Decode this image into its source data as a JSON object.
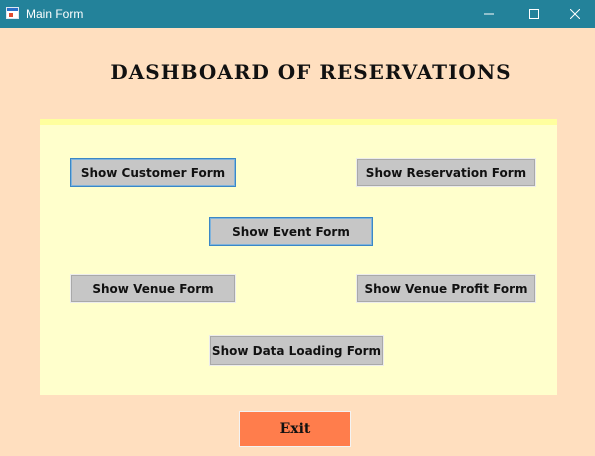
{
  "window": {
    "title": "Main Form",
    "titlebar_color": "#23829a",
    "app_icon": "form-app-icon",
    "controls": [
      "minimize-icon",
      "maximize-icon",
      "close-icon"
    ]
  },
  "heading": "DASHBOARD OF RESERVATIONS",
  "colors": {
    "background": "#ffdfbf",
    "panel": "#ffffcc",
    "button": "#c6c6c6",
    "exit_button": "#ff7d4c"
  },
  "buttons": {
    "customer": "Show Customer Form",
    "reservation": "Show Reservation Form",
    "event": "Show Event Form",
    "venue": "Show Venue Form",
    "venue_profit": "Show Venue Profit Form",
    "data_loading": "Show Data Loading Form"
  },
  "exit_label": "Exit"
}
